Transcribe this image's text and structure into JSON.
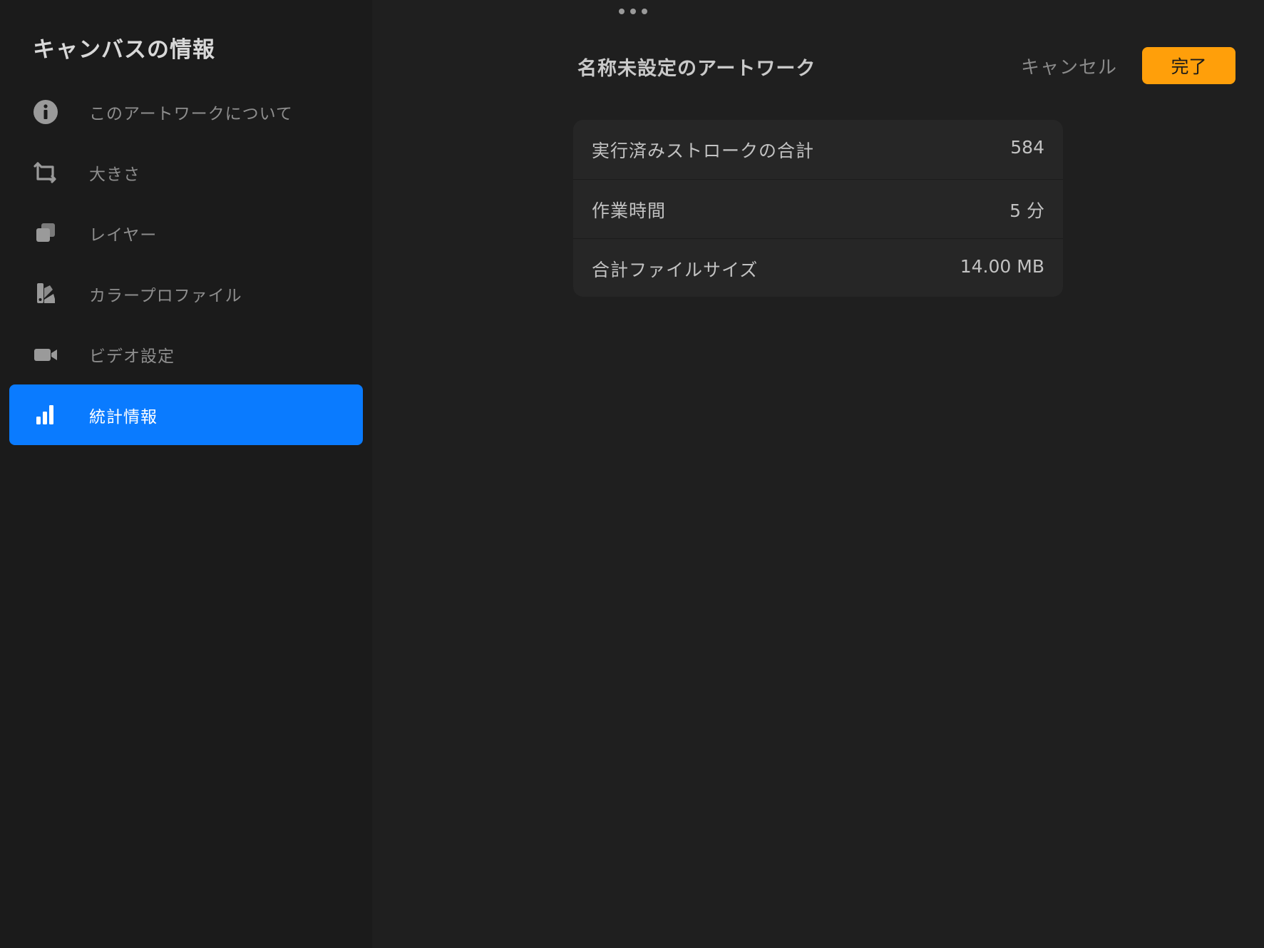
{
  "sidebar": {
    "title": "キャンバスの情報",
    "items": [
      {
        "label": "このアートワークについて",
        "icon": "info-icon"
      },
      {
        "label": "大きさ",
        "icon": "crop-icon"
      },
      {
        "label": "レイヤー",
        "icon": "layers-icon"
      },
      {
        "label": "カラープロファイル",
        "icon": "color-swatch-icon"
      },
      {
        "label": "ビデオ設定",
        "icon": "video-camera-icon"
      },
      {
        "label": "統計情報",
        "icon": "bar-chart-icon",
        "active": true
      }
    ]
  },
  "header": {
    "artwork_title": "名称未設定のアートワーク",
    "cancel_label": "キャンセル",
    "done_label": "完了"
  },
  "stats": {
    "rows": [
      {
        "label": "実行済みストロークの合計",
        "value": "584"
      },
      {
        "label": "作業時間",
        "value": "5 分"
      },
      {
        "label": "合計ファイルサイズ",
        "value": "14.00 MB"
      }
    ]
  },
  "colors": {
    "accent_active": "#0a7bff",
    "done_button": "#ff9f0a",
    "sidebar_bg": "#1b1b1b",
    "main_bg": "#1f1f1f"
  }
}
